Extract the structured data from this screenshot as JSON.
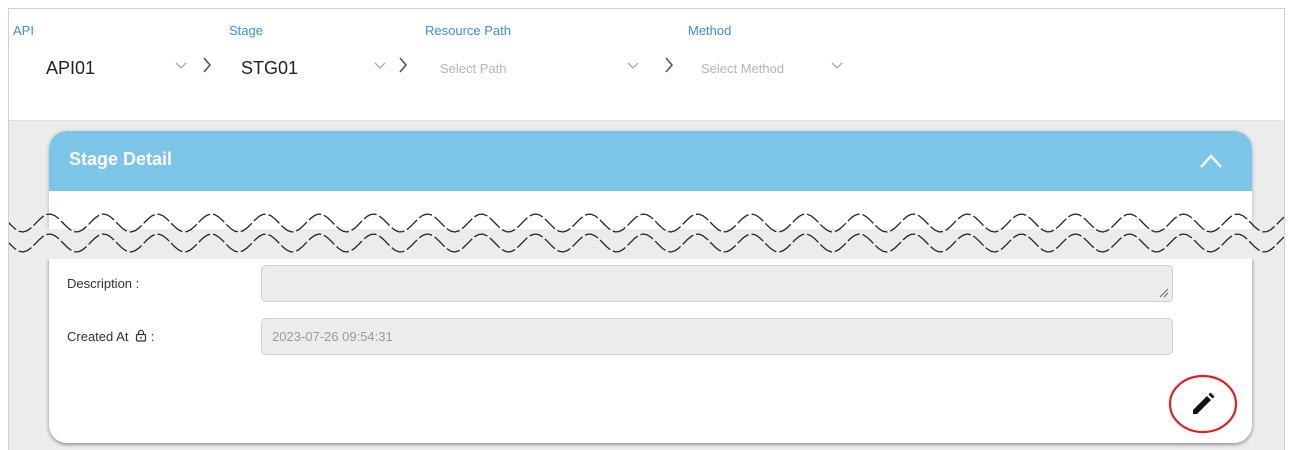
{
  "selectors": {
    "api": {
      "label": "API",
      "value": "API01"
    },
    "stage": {
      "label": "Stage",
      "value": "STG01"
    },
    "resource_path": {
      "label": "Resource Path",
      "placeholder": "Select Path"
    },
    "method": {
      "label": "Method",
      "placeholder": "Select Method"
    }
  },
  "card": {
    "title": "Stage Detail",
    "collapse_icon": "chevron-up-icon"
  },
  "fields": {
    "description": {
      "label": "Description :",
      "value": ""
    },
    "created_at": {
      "label": "Created At",
      "label_suffix": ":",
      "lock_icon": "lock-icon",
      "value": "2023-07-26 09:54:31"
    }
  },
  "actions": {
    "edit_icon": "pencil-icon",
    "highlight_color": "#e02020"
  },
  "colors": {
    "accent_label": "#3d8fd1",
    "header_bg": "#7cc4e8"
  }
}
